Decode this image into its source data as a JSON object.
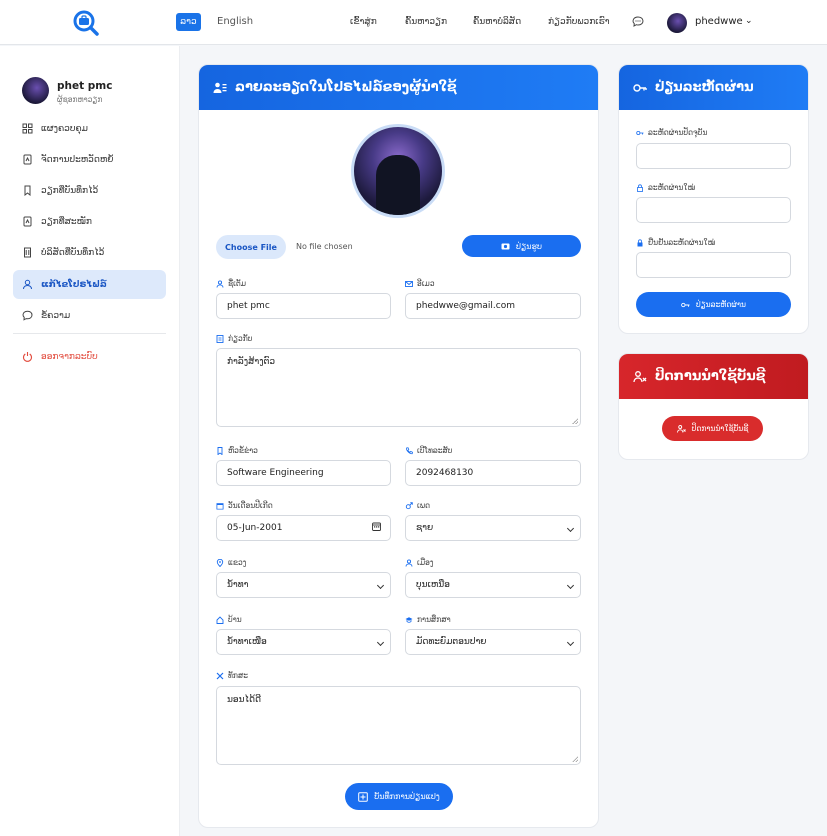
{
  "header": {
    "lang_active": "ລາວ",
    "lang_other": "English",
    "nav": [
      "ເຂົ້າສູ່ກ",
      "ຄົ້ນຫາວຽກ",
      "ຄົ້ນຫາບໍລິສັດ",
      "ກ່ຽວກັບພວກເຮົາ"
    ],
    "username": "phedwwe"
  },
  "sidebar": {
    "name": "phet pmc",
    "role": "ຜູ້ຊອກຫາວຽກ",
    "items": [
      {
        "label": "ແຜງຄວບຄຸມ",
        "icon": "dashboard-icon"
      },
      {
        "label": "ຈັດການປະຫວັດຫຍໍ້",
        "icon": "resume-icon"
      },
      {
        "label": "ວຽກທີ່ບັນທຶກໄວ້",
        "icon": "bookmark-icon"
      },
      {
        "label": "ວຽກທີ່ສະໝັກ",
        "icon": "applied-icon"
      },
      {
        "label": "ບໍລິສັດທີ່ບັນທຶກໄວ້",
        "icon": "building-icon"
      },
      {
        "label": "ແກ້ໄຂໂປຣໄຟລ໌",
        "icon": "user-icon"
      },
      {
        "label": "ຂໍ້ຄວາມ",
        "icon": "message-icon"
      }
    ],
    "logout": "ອອກຈາກລະບົບ",
    "active_index": 5
  },
  "profile": {
    "header": "ລາຍລະອຽດໃນໂປຣໄຟລ໌ຂອງຜູ້ນຳໃຊ້",
    "choose_file": "Choose File",
    "no_file": "No file chosen",
    "update_photo": "ປ່ຽນຮູບ",
    "fields": {
      "name_label": "ຊື່ເຕັມ",
      "name": "phet pmc",
      "email_label": "ອີເມວ",
      "email": "phedwwe@gmail.com",
      "about_label": "ກ່ຽວກັບ",
      "about": "ກຳລັງສ້າງຕົວ",
      "title_label": "ຫົວຂໍ້ຂ່າວ",
      "title": "Software Engineering",
      "phone_label": "ເບີໂທລະສັບ",
      "phone": "2092468130",
      "dob_label": "ວັນເດືອນປີເກີດ",
      "dob": "05-Jun-2001",
      "gender_label": "ເພດ",
      "gender": "ຊາຍ",
      "province_label": "ແຂວງ",
      "province": "ນໍ້າທາ",
      "district_label": "ເມືອງ",
      "district": "ບຸນເຫນືອ",
      "village_label": "ບ້ານ",
      "village": "ນໍ້າທາເໜືອ",
      "education_label": "ການສຶກສາ",
      "education": "ມັດທະຍົມຕອນປາຍ",
      "skills_label": "ທັກສະ",
      "skills": "ນອນໄດ້ດີ"
    },
    "save": "ບັນທຶກການປ່ຽນແປງ"
  },
  "password": {
    "header": "ປ່ຽນລະຫັດຜ່ານ",
    "current_label": "ລະຫັດຜ່ານປັດຈຸບັນ",
    "new_label": "ລະຫັດຜ່ານໃໝ່",
    "confirm_label": "ຢືນຢັນລະຫັດຜ່ານໃໝ່",
    "button": "ປ່ຽນລະຫັດຜ່ານ"
  },
  "deactivate": {
    "header": "ປິດການນຳໃຊ້ບັນຊີ",
    "button": "ປິດການນຳໃຊ້ບັນຊີ"
  },
  "colors": {
    "primary": "#1a6ef0",
    "danger": "#d92c2c",
    "active_bg": "#dde9fb"
  }
}
